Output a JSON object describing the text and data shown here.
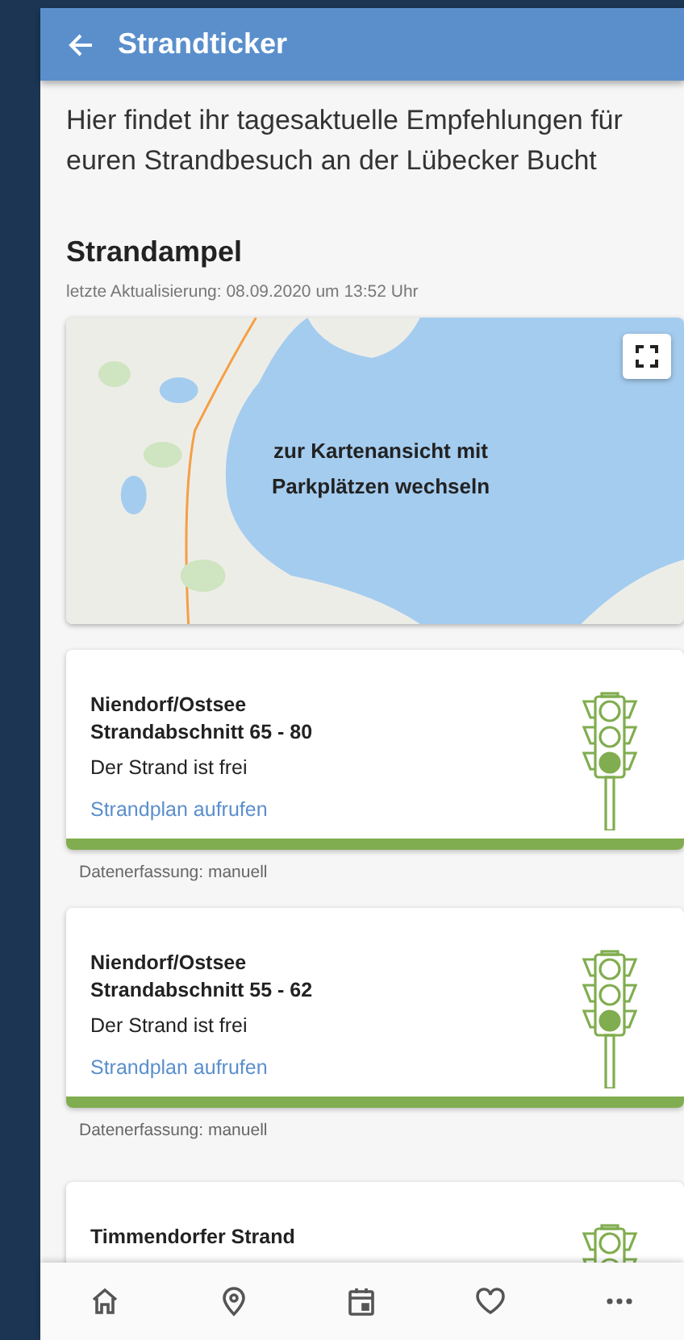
{
  "header": {
    "title": "Strandticker"
  },
  "intro": "Hier findet ihr tagesaktuelle Empfehlungen für euren Strandbesuch an der Lübecker Bucht",
  "section": {
    "title": "Strandampel",
    "updated": "letzte Aktualisierung: 08.09.2020 um 13:52 Uhr"
  },
  "map": {
    "caption": "zur Kartenansicht mit Parkplätzen wechseln"
  },
  "beaches": [
    {
      "place": "Niendorf/Ostsee",
      "section": "Strandabschnitt 65 - 80",
      "status": "Der Strand ist frei",
      "link": "Strandplan aufrufen",
      "kind": "green",
      "source": "Datenerfassung: manuell"
    },
    {
      "place": "Niendorf/Ostsee",
      "section": "Strandabschnitt 55 - 62",
      "status": "Der Strand ist frei",
      "link": "Strandplan aufrufen",
      "kind": "green",
      "source": "Datenerfassung: manuell"
    },
    {
      "place": "Timmendorfer Strand",
      "kind": "green"
    }
  ]
}
